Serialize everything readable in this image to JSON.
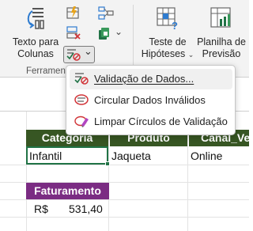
{
  "ribbon": {
    "text_to_columns": {
      "line1": "Texto para",
      "line2": "Colunas"
    },
    "what_if": {
      "line1": "Teste de",
      "line2": "Hipóteses",
      "caret": "⌄"
    },
    "forecast_sheet": {
      "line1": "Planilha de",
      "line2": "Previsão"
    },
    "group_label": "Ferramen",
    "data_validation_caret": "⌄",
    "small_caret": "⌄"
  },
  "menu": {
    "items": [
      {
        "label": "Validação de Dados...",
        "accel": "V",
        "icon": "data-validation-icon",
        "highlighted": true
      },
      {
        "label": "Circular Dados Inválidos",
        "accel": "C",
        "icon": "circle-invalid-icon",
        "highlighted": false
      },
      {
        "label": "Limpar Círculos de Validação",
        "accel": "L",
        "icon": "clear-circles-icon",
        "highlighted": false
      }
    ]
  },
  "table": {
    "headers": [
      "Categoria",
      "Produto",
      "Canal_Ve"
    ],
    "row": [
      "Infantil",
      "Jaqueta",
      "Online"
    ]
  },
  "faturamento": {
    "header": "Faturamento",
    "currency": "R$",
    "value": "531,40"
  },
  "colors": {
    "header_green": "#375623",
    "faturamento_purple": "#7b2c83",
    "selection_green": "#217346"
  }
}
